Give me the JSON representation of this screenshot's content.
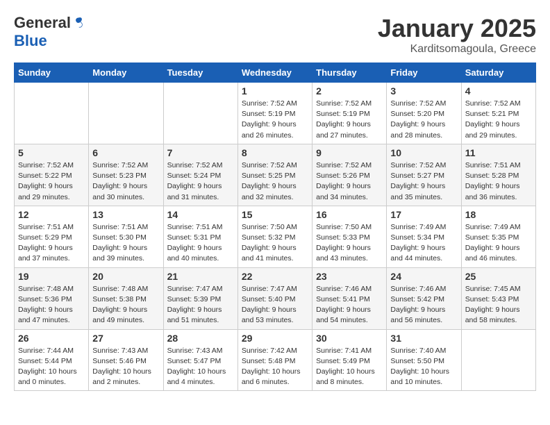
{
  "logo": {
    "general": "General",
    "blue": "Blue"
  },
  "title": "January 2025",
  "location": "Karditsomagoula, Greece",
  "days_header": [
    "Sunday",
    "Monday",
    "Tuesday",
    "Wednesday",
    "Thursday",
    "Friday",
    "Saturday"
  ],
  "weeks": [
    [
      {
        "day": "",
        "info": ""
      },
      {
        "day": "",
        "info": ""
      },
      {
        "day": "",
        "info": ""
      },
      {
        "day": "1",
        "info": "Sunrise: 7:52 AM\nSunset: 5:19 PM\nDaylight: 9 hours\nand 26 minutes."
      },
      {
        "day": "2",
        "info": "Sunrise: 7:52 AM\nSunset: 5:19 PM\nDaylight: 9 hours\nand 27 minutes."
      },
      {
        "day": "3",
        "info": "Sunrise: 7:52 AM\nSunset: 5:20 PM\nDaylight: 9 hours\nand 28 minutes."
      },
      {
        "day": "4",
        "info": "Sunrise: 7:52 AM\nSunset: 5:21 PM\nDaylight: 9 hours\nand 29 minutes."
      }
    ],
    [
      {
        "day": "5",
        "info": "Sunrise: 7:52 AM\nSunset: 5:22 PM\nDaylight: 9 hours\nand 29 minutes."
      },
      {
        "day": "6",
        "info": "Sunrise: 7:52 AM\nSunset: 5:23 PM\nDaylight: 9 hours\nand 30 minutes."
      },
      {
        "day": "7",
        "info": "Sunrise: 7:52 AM\nSunset: 5:24 PM\nDaylight: 9 hours\nand 31 minutes."
      },
      {
        "day": "8",
        "info": "Sunrise: 7:52 AM\nSunset: 5:25 PM\nDaylight: 9 hours\nand 32 minutes."
      },
      {
        "day": "9",
        "info": "Sunrise: 7:52 AM\nSunset: 5:26 PM\nDaylight: 9 hours\nand 34 minutes."
      },
      {
        "day": "10",
        "info": "Sunrise: 7:52 AM\nSunset: 5:27 PM\nDaylight: 9 hours\nand 35 minutes."
      },
      {
        "day": "11",
        "info": "Sunrise: 7:51 AM\nSunset: 5:28 PM\nDaylight: 9 hours\nand 36 minutes."
      }
    ],
    [
      {
        "day": "12",
        "info": "Sunrise: 7:51 AM\nSunset: 5:29 PM\nDaylight: 9 hours\nand 37 minutes."
      },
      {
        "day": "13",
        "info": "Sunrise: 7:51 AM\nSunset: 5:30 PM\nDaylight: 9 hours\nand 39 minutes."
      },
      {
        "day": "14",
        "info": "Sunrise: 7:51 AM\nSunset: 5:31 PM\nDaylight: 9 hours\nand 40 minutes."
      },
      {
        "day": "15",
        "info": "Sunrise: 7:50 AM\nSunset: 5:32 PM\nDaylight: 9 hours\nand 41 minutes."
      },
      {
        "day": "16",
        "info": "Sunrise: 7:50 AM\nSunset: 5:33 PM\nDaylight: 9 hours\nand 43 minutes."
      },
      {
        "day": "17",
        "info": "Sunrise: 7:49 AM\nSunset: 5:34 PM\nDaylight: 9 hours\nand 44 minutes."
      },
      {
        "day": "18",
        "info": "Sunrise: 7:49 AM\nSunset: 5:35 PM\nDaylight: 9 hours\nand 46 minutes."
      }
    ],
    [
      {
        "day": "19",
        "info": "Sunrise: 7:48 AM\nSunset: 5:36 PM\nDaylight: 9 hours\nand 47 minutes."
      },
      {
        "day": "20",
        "info": "Sunrise: 7:48 AM\nSunset: 5:38 PM\nDaylight: 9 hours\nand 49 minutes."
      },
      {
        "day": "21",
        "info": "Sunrise: 7:47 AM\nSunset: 5:39 PM\nDaylight: 9 hours\nand 51 minutes."
      },
      {
        "day": "22",
        "info": "Sunrise: 7:47 AM\nSunset: 5:40 PM\nDaylight: 9 hours\nand 53 minutes."
      },
      {
        "day": "23",
        "info": "Sunrise: 7:46 AM\nSunset: 5:41 PM\nDaylight: 9 hours\nand 54 minutes."
      },
      {
        "day": "24",
        "info": "Sunrise: 7:46 AM\nSunset: 5:42 PM\nDaylight: 9 hours\nand 56 minutes."
      },
      {
        "day": "25",
        "info": "Sunrise: 7:45 AM\nSunset: 5:43 PM\nDaylight: 9 hours\nand 58 minutes."
      }
    ],
    [
      {
        "day": "26",
        "info": "Sunrise: 7:44 AM\nSunset: 5:44 PM\nDaylight: 10 hours\nand 0 minutes."
      },
      {
        "day": "27",
        "info": "Sunrise: 7:43 AM\nSunset: 5:46 PM\nDaylight: 10 hours\nand 2 minutes."
      },
      {
        "day": "28",
        "info": "Sunrise: 7:43 AM\nSunset: 5:47 PM\nDaylight: 10 hours\nand 4 minutes."
      },
      {
        "day": "29",
        "info": "Sunrise: 7:42 AM\nSunset: 5:48 PM\nDaylight: 10 hours\nand 6 minutes."
      },
      {
        "day": "30",
        "info": "Sunrise: 7:41 AM\nSunset: 5:49 PM\nDaylight: 10 hours\nand 8 minutes."
      },
      {
        "day": "31",
        "info": "Sunrise: 7:40 AM\nSunset: 5:50 PM\nDaylight: 10 hours\nand 10 minutes."
      },
      {
        "day": "",
        "info": ""
      }
    ]
  ]
}
